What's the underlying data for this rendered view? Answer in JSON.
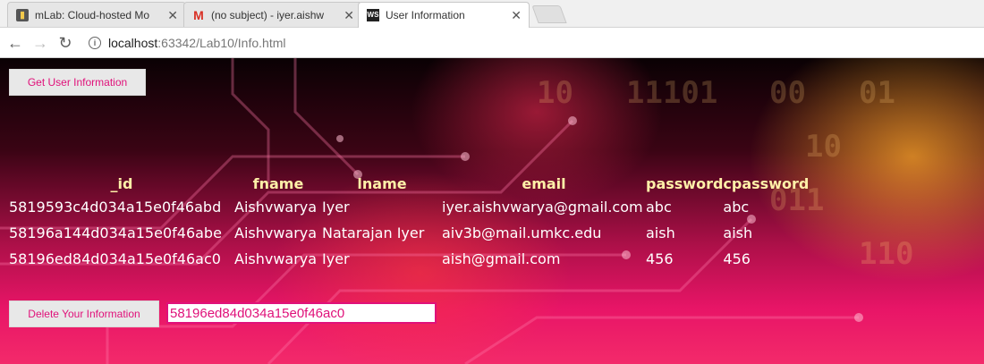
{
  "browser": {
    "tabs": [
      {
        "title": "mLab: Cloud-hosted Mo",
        "icon": "mlab-favicon-icon",
        "active": false
      },
      {
        "title": "(no subject) - iyer.aishw",
        "icon": "gmail-favicon-icon",
        "active": false
      },
      {
        "title": "User Information",
        "icon": "webstorm-favicon-icon",
        "active": true
      }
    ],
    "favicons": {
      "mlab": "▮",
      "gmail": "M",
      "ws": "WS"
    },
    "close_glyph": "✕",
    "nav": {
      "back": "←",
      "forward": "→",
      "reload": "↻"
    },
    "address": {
      "host": "localhost",
      "rest": ":63342/Lab10/Info.html",
      "info_glyph": "i"
    }
  },
  "page": {
    "get_button_label": "Get User Information",
    "table": {
      "columns": [
        "_id",
        "fname",
        "lname",
        "email",
        "password",
        "cpassword"
      ],
      "rows": [
        [
          "5819593c4d034a15e0f46abd",
          "Aishvwarya",
          "Iyer",
          "iyer.aishvwarya@gmail.com",
          "abc",
          "abc"
        ],
        [
          "58196a144d034a15e0f46abe",
          "Aishvwarya",
          "Natarajan Iyer",
          "aiv3b@mail.umkc.edu",
          "aish",
          "aish"
        ],
        [
          "58196ed84d034a15e0f46ac0",
          "Aishvwarya",
          "Iyer",
          "aish@gmail.com",
          "456",
          "456"
        ]
      ]
    },
    "delete_button_label": "Delete Your Information",
    "delete_input_value": "58196ed84d034a15e0f46ac0",
    "colors": {
      "accent": "#e0117a",
      "header_text": "#fff0a8",
      "cell_text": "#ffffff"
    }
  }
}
